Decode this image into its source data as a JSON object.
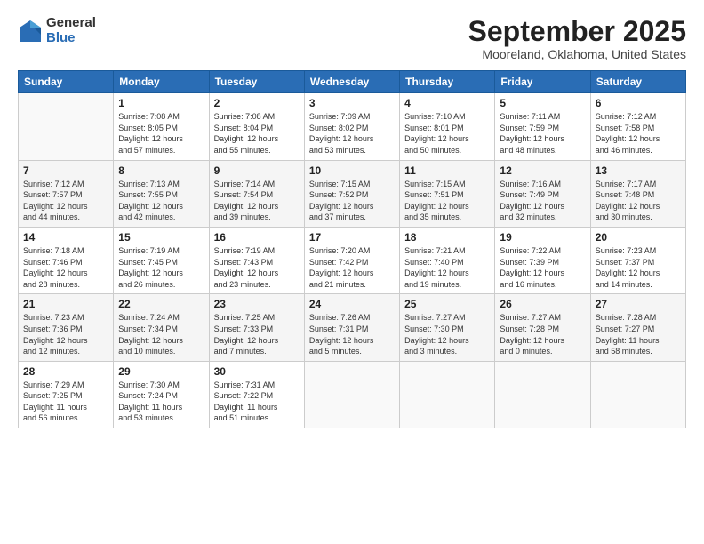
{
  "logo": {
    "general": "General",
    "blue": "Blue"
  },
  "title": "September 2025",
  "location": "Mooreland, Oklahoma, United States",
  "headers": [
    "Sunday",
    "Monday",
    "Tuesday",
    "Wednesday",
    "Thursday",
    "Friday",
    "Saturday"
  ],
  "weeks": [
    [
      {
        "day": "",
        "info": ""
      },
      {
        "day": "1",
        "info": "Sunrise: 7:08 AM\nSunset: 8:05 PM\nDaylight: 12 hours\nand 57 minutes."
      },
      {
        "day": "2",
        "info": "Sunrise: 7:08 AM\nSunset: 8:04 PM\nDaylight: 12 hours\nand 55 minutes."
      },
      {
        "day": "3",
        "info": "Sunrise: 7:09 AM\nSunset: 8:02 PM\nDaylight: 12 hours\nand 53 minutes."
      },
      {
        "day": "4",
        "info": "Sunrise: 7:10 AM\nSunset: 8:01 PM\nDaylight: 12 hours\nand 50 minutes."
      },
      {
        "day": "5",
        "info": "Sunrise: 7:11 AM\nSunset: 7:59 PM\nDaylight: 12 hours\nand 48 minutes."
      },
      {
        "day": "6",
        "info": "Sunrise: 7:12 AM\nSunset: 7:58 PM\nDaylight: 12 hours\nand 46 minutes."
      }
    ],
    [
      {
        "day": "7",
        "info": "Sunrise: 7:12 AM\nSunset: 7:57 PM\nDaylight: 12 hours\nand 44 minutes."
      },
      {
        "day": "8",
        "info": "Sunrise: 7:13 AM\nSunset: 7:55 PM\nDaylight: 12 hours\nand 42 minutes."
      },
      {
        "day": "9",
        "info": "Sunrise: 7:14 AM\nSunset: 7:54 PM\nDaylight: 12 hours\nand 39 minutes."
      },
      {
        "day": "10",
        "info": "Sunrise: 7:15 AM\nSunset: 7:52 PM\nDaylight: 12 hours\nand 37 minutes."
      },
      {
        "day": "11",
        "info": "Sunrise: 7:15 AM\nSunset: 7:51 PM\nDaylight: 12 hours\nand 35 minutes."
      },
      {
        "day": "12",
        "info": "Sunrise: 7:16 AM\nSunset: 7:49 PM\nDaylight: 12 hours\nand 32 minutes."
      },
      {
        "day": "13",
        "info": "Sunrise: 7:17 AM\nSunset: 7:48 PM\nDaylight: 12 hours\nand 30 minutes."
      }
    ],
    [
      {
        "day": "14",
        "info": "Sunrise: 7:18 AM\nSunset: 7:46 PM\nDaylight: 12 hours\nand 28 minutes."
      },
      {
        "day": "15",
        "info": "Sunrise: 7:19 AM\nSunset: 7:45 PM\nDaylight: 12 hours\nand 26 minutes."
      },
      {
        "day": "16",
        "info": "Sunrise: 7:19 AM\nSunset: 7:43 PM\nDaylight: 12 hours\nand 23 minutes."
      },
      {
        "day": "17",
        "info": "Sunrise: 7:20 AM\nSunset: 7:42 PM\nDaylight: 12 hours\nand 21 minutes."
      },
      {
        "day": "18",
        "info": "Sunrise: 7:21 AM\nSunset: 7:40 PM\nDaylight: 12 hours\nand 19 minutes."
      },
      {
        "day": "19",
        "info": "Sunrise: 7:22 AM\nSunset: 7:39 PM\nDaylight: 12 hours\nand 16 minutes."
      },
      {
        "day": "20",
        "info": "Sunrise: 7:23 AM\nSunset: 7:37 PM\nDaylight: 12 hours\nand 14 minutes."
      }
    ],
    [
      {
        "day": "21",
        "info": "Sunrise: 7:23 AM\nSunset: 7:36 PM\nDaylight: 12 hours\nand 12 minutes."
      },
      {
        "day": "22",
        "info": "Sunrise: 7:24 AM\nSunset: 7:34 PM\nDaylight: 12 hours\nand 10 minutes."
      },
      {
        "day": "23",
        "info": "Sunrise: 7:25 AM\nSunset: 7:33 PM\nDaylight: 12 hours\nand 7 minutes."
      },
      {
        "day": "24",
        "info": "Sunrise: 7:26 AM\nSunset: 7:31 PM\nDaylight: 12 hours\nand 5 minutes."
      },
      {
        "day": "25",
        "info": "Sunrise: 7:27 AM\nSunset: 7:30 PM\nDaylight: 12 hours\nand 3 minutes."
      },
      {
        "day": "26",
        "info": "Sunrise: 7:27 AM\nSunset: 7:28 PM\nDaylight: 12 hours\nand 0 minutes."
      },
      {
        "day": "27",
        "info": "Sunrise: 7:28 AM\nSunset: 7:27 PM\nDaylight: 11 hours\nand 58 minutes."
      }
    ],
    [
      {
        "day": "28",
        "info": "Sunrise: 7:29 AM\nSunset: 7:25 PM\nDaylight: 11 hours\nand 56 minutes."
      },
      {
        "day": "29",
        "info": "Sunrise: 7:30 AM\nSunset: 7:24 PM\nDaylight: 11 hours\nand 53 minutes."
      },
      {
        "day": "30",
        "info": "Sunrise: 7:31 AM\nSunset: 7:22 PM\nDaylight: 11 hours\nand 51 minutes."
      },
      {
        "day": "",
        "info": ""
      },
      {
        "day": "",
        "info": ""
      },
      {
        "day": "",
        "info": ""
      },
      {
        "day": "",
        "info": ""
      }
    ]
  ]
}
